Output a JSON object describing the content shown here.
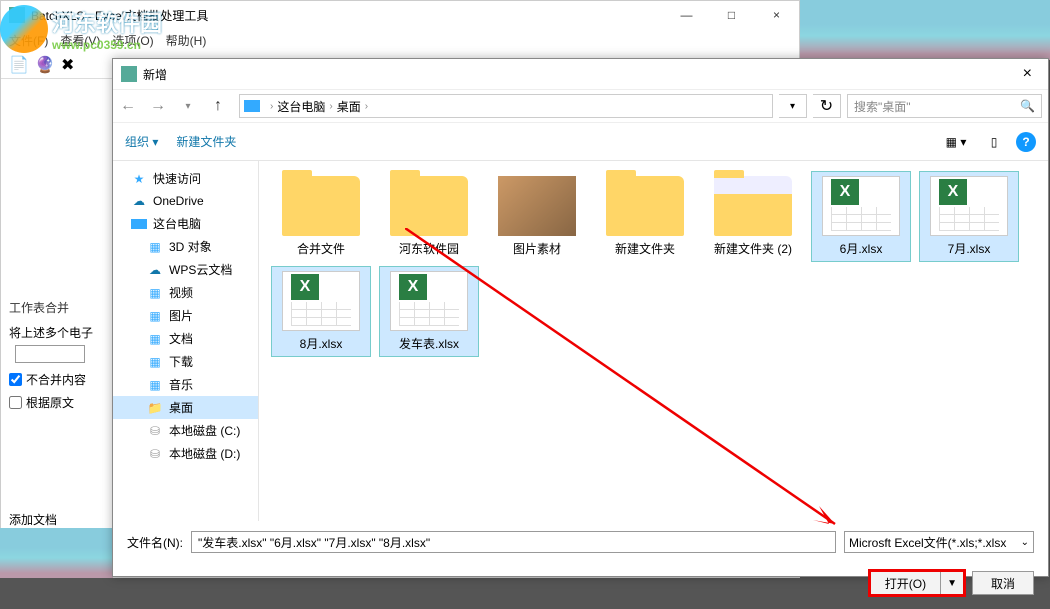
{
  "watermark": {
    "title": "河东软件园",
    "url": "www.pc0359.cn"
  },
  "bg_app": {
    "title": "BatchXLS - Excel文档批处理工具",
    "menus": [
      "文件(F)",
      "查看(V)",
      "选项(O)",
      "帮助(H)"
    ],
    "win": {
      "min": "—",
      "max": "□",
      "close": "×"
    },
    "panel": {
      "sec1": "工作表合并",
      "label1": "将上述多个电子",
      "cb1": "不合并内容",
      "cb2": "根据原文"
    },
    "add_doc": "添加文档"
  },
  "dialog": {
    "title": "新增",
    "close": "×",
    "breadcrumb": {
      "pc": "这台电脑",
      "desktop": "桌面"
    },
    "search_placeholder": "搜索\"桌面\"",
    "toolbar": {
      "organize": "组织",
      "new_folder": "新建文件夹",
      "help": "?"
    },
    "tree": [
      {
        "icon": "star",
        "label": "快速访问",
        "l": 1
      },
      {
        "icon": "cloud",
        "label": "OneDrive",
        "l": 1
      },
      {
        "icon": "pc",
        "label": "这台电脑",
        "l": 1
      },
      {
        "icon": "blue",
        "label": "3D 对象",
        "l": 2
      },
      {
        "icon": "cloud",
        "label": "WPS云文档",
        "l": 2
      },
      {
        "icon": "blue",
        "label": "视频",
        "l": 2
      },
      {
        "icon": "blue",
        "label": "图片",
        "l": 2
      },
      {
        "icon": "blue",
        "label": "文档",
        "l": 2
      },
      {
        "icon": "blue",
        "label": "下载",
        "l": 2
      },
      {
        "icon": "blue",
        "label": "音乐",
        "l": 2
      },
      {
        "icon": "folder",
        "label": "桌面",
        "l": 2,
        "sel": true
      },
      {
        "icon": "disk",
        "label": "本地磁盘 (C:)",
        "l": 2
      },
      {
        "icon": "disk",
        "label": "本地磁盘 (D:)",
        "l": 2
      }
    ],
    "files": [
      {
        "name": "合并文件",
        "type": "folder"
      },
      {
        "name": "河东软件园",
        "type": "folder"
      },
      {
        "name": "图片素材",
        "type": "img"
      },
      {
        "name": "新建文件夹",
        "type": "folder"
      },
      {
        "name": "新建文件夹 (2)",
        "type": "folder-preview"
      },
      {
        "name": "6月.xlsx",
        "type": "xlsx",
        "sel": true
      },
      {
        "name": "7月.xlsx",
        "type": "xlsx",
        "sel": true
      },
      {
        "name": "8月.xlsx",
        "type": "xlsx",
        "sel": true
      },
      {
        "name": "发车表.xlsx",
        "type": "xlsx",
        "sel": true
      }
    ],
    "fn_label": "文件名(N):",
    "fn_value": "\"发车表.xlsx\" \"6月.xlsx\" \"7月.xlsx\" \"8月.xlsx\"",
    "ft_value": "Microsft Excel文件(*.xls;*.xlsx",
    "btn_open": "打开(O)",
    "btn_cancel": "取消"
  }
}
